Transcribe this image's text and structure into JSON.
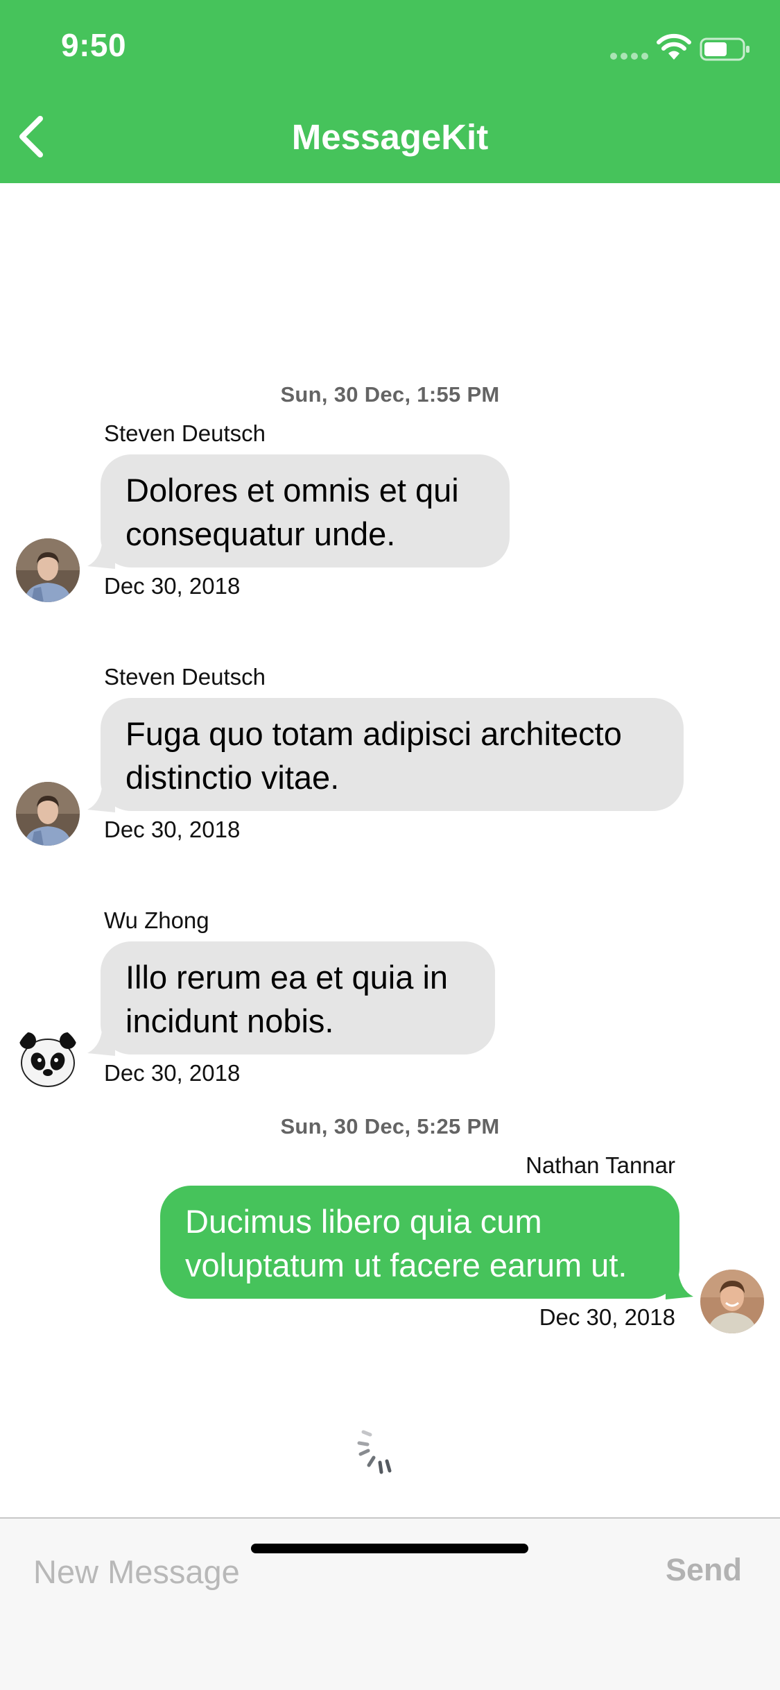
{
  "status_bar": {
    "time": "9:50"
  },
  "nav": {
    "title": "MessageKit",
    "back_icon": "chevron-left-icon"
  },
  "colors": {
    "accent": "#46c35b",
    "incoming_bubble": "#e5e5e5",
    "timestamp_text": "#646464"
  },
  "timestamps": [
    "Sun, 30 Dec, 1:55 PM",
    "Sun, 30 Dec, 5:25 PM"
  ],
  "messages": [
    {
      "sender": "Steven Deutsch",
      "lines": [
        "Dolores et omnis et qui",
        "consequatur unde."
      ],
      "date": "Dec 30, 2018",
      "direction": "incoming"
    },
    {
      "sender": "Steven Deutsch",
      "lines": [
        "Fuga quo totam adipisci architecto",
        "distinctio vitae."
      ],
      "date": "Dec 30, 2018",
      "direction": "incoming"
    },
    {
      "sender": "Wu Zhong",
      "lines": [
        "Illo rerum ea et quia in",
        "incidunt nobis."
      ],
      "date": "Dec 30, 2018",
      "direction": "incoming"
    },
    {
      "sender": "Nathan Tannar",
      "lines": [
        "Ducimus libero quia cum",
        "voluptatum ut facere earum ut."
      ],
      "date": "Dec 30, 2018",
      "direction": "outgoing"
    }
  ],
  "input": {
    "placeholder": "New Message",
    "value": "",
    "send_label": "Send"
  }
}
